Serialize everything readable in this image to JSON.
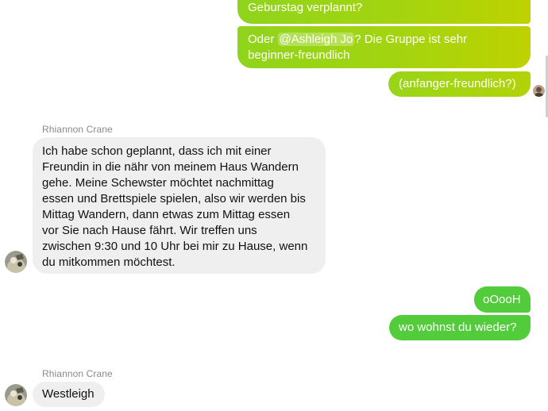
{
  "thread": {
    "messages": [
      {
        "id": "m1",
        "direction": "outgoing",
        "text": "Geburstag verplannt?"
      },
      {
        "id": "m2",
        "direction": "outgoing",
        "prefix": "Oder ",
        "mention": "@Ashleigh Jo",
        "suffix_line1": "? Die Gruppe ist sehr",
        "line2": "beginner-freundlich"
      },
      {
        "id": "m3",
        "direction": "outgoing",
        "text": "(anfanger-freundlich?)"
      },
      {
        "id": "m4",
        "direction": "incoming",
        "sender": "Rhiannon Crane",
        "lines": [
          "Ich habe schon geplannt, dass ich mit einer",
          "Freundin in die nähr von meinem Haus Wandern",
          "gehe. Meine Schewster möchtet nachmittag",
          "essen und Brettspiele spielen, also wir werden bis",
          "Mittag Wandern, dann etwas zum Mittag essen",
          "vor Sie nach Hause fährt. Wir treffen uns",
          "zwischen 9:30 und 10 Uhr bei mir zu Hause, wenn",
          "du mitkommen möchtest."
        ]
      },
      {
        "id": "m5",
        "direction": "outgoing",
        "text": "oOooH"
      },
      {
        "id": "m6",
        "direction": "outgoing",
        "text": "wo wohnst du wieder?"
      },
      {
        "id": "m7",
        "direction": "incoming",
        "sender": "Rhiannon Crane",
        "text": "Westleigh"
      }
    ]
  },
  "colors": {
    "outgoing_gradient_start": "#8fd41c",
    "outgoing_gradient_end": "#bed200",
    "outgoing_solid": "#52cc3a",
    "incoming_bubble": "#efefef",
    "sender_label": "#8a8a8a"
  },
  "icons": {
    "self_read_receipt": "user-avatar-icon",
    "other_avatar": "contact-avatar-icon"
  }
}
